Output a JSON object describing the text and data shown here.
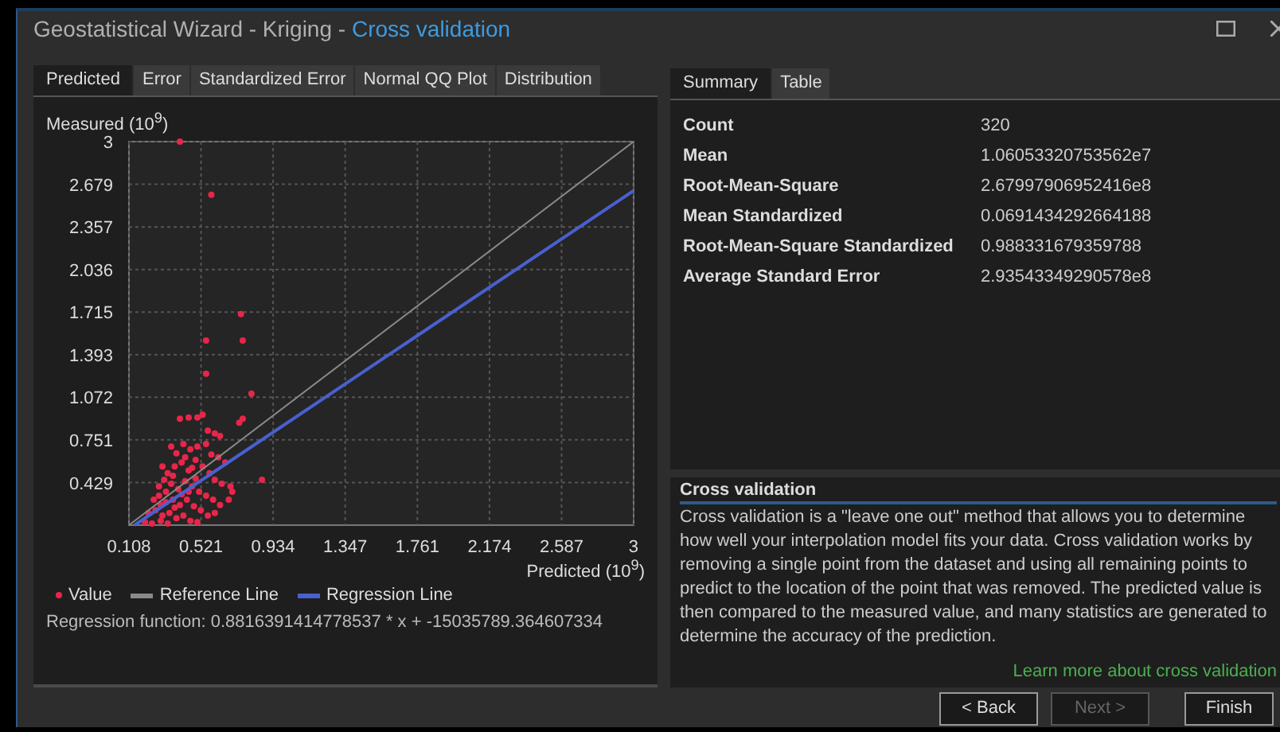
{
  "window": {
    "title_parts": [
      {
        "text": "Geostatistical Wizard - Kriging - ",
        "highlight": false
      },
      {
        "text": "Cross validation",
        "highlight": true
      }
    ]
  },
  "left_tabs": [
    {
      "label": "Predicted",
      "selected": true
    },
    {
      "label": "Error",
      "selected": false
    },
    {
      "label": "Standardized Error",
      "selected": false
    },
    {
      "label": "Normal QQ Plot",
      "selected": false
    },
    {
      "label": "Distribution",
      "selected": false
    }
  ],
  "plot": {
    "ylabel": "Measured (10$^{9}$)",
    "xlabel": "Predicted (10$^{9}$)",
    "chart_data": {
      "type": "scatter",
      "grid": true,
      "xlim": [
        0.108,
        3
      ],
      "ylim": [
        0.108,
        3
      ],
      "xticks": [
        0.108,
        0.521,
        0.934,
        1.347,
        1.761,
        2.174,
        2.587,
        3
      ],
      "yticks": [
        0.429,
        0.751,
        1.072,
        1.393,
        1.715,
        2.036,
        2.357,
        2.679,
        3
      ],
      "series": [
        {
          "name": "Value",
          "color": "#e8264a",
          "x": [
            0.4,
            0.58,
            0.55,
            0.55,
            0.75,
            0.76,
            0.81,
            0.76,
            0.74,
            0.87,
            0.4,
            0.45,
            0.5,
            0.53,
            0.56,
            0.6,
            0.63,
            0.66,
            0.69,
            0.7,
            0.68,
            0.35,
            0.38,
            0.42,
            0.46,
            0.5,
            0.55,
            0.58,
            0.62,
            0.3,
            0.33,
            0.37,
            0.41,
            0.45,
            0.49,
            0.53,
            0.57,
            0.6,
            0.64,
            0.28,
            0.31,
            0.35,
            0.39,
            0.43,
            0.47,
            0.51,
            0.55,
            0.59,
            0.63,
            0.25,
            0.28,
            0.32,
            0.36,
            0.4,
            0.44,
            0.48,
            0.52,
            0.56,
            0.6,
            0.22,
            0.26,
            0.3,
            0.34,
            0.38,
            0.42,
            0.46,
            0.5,
            0.2,
            0.24,
            0.29,
            0.33,
            0.37,
            0.41,
            0.45,
            0.49,
            0.32,
            0.36,
            0.29,
            0.43,
            0.47
          ],
          "values": [
            3.0,
            2.6,
            1.5,
            1.25,
            1.7,
            1.5,
            1.1,
            0.91,
            0.88,
            0.45,
            0.91,
            0.92,
            0.92,
            0.94,
            0.82,
            0.8,
            0.78,
            0.58,
            0.4,
            0.36,
            0.3,
            0.7,
            0.65,
            0.72,
            0.68,
            0.7,
            0.72,
            0.64,
            0.62,
            0.55,
            0.5,
            0.55,
            0.58,
            0.52,
            0.6,
            0.55,
            0.5,
            0.45,
            0.42,
            0.4,
            0.45,
            0.42,
            0.38,
            0.44,
            0.4,
            0.36,
            0.33,
            0.3,
            0.26,
            0.3,
            0.33,
            0.28,
            0.3,
            0.26,
            0.3,
            0.25,
            0.22,
            0.18,
            0.2,
            0.2,
            0.22,
            0.18,
            0.2,
            0.16,
            0.18,
            0.14,
            0.13,
            0.13,
            0.12,
            0.14,
            0.12,
            0.24,
            0.34,
            0.36,
            0.46,
            0.36,
            0.48,
            0.26,
            0.62,
            0.54
          ]
        },
        {
          "name": "Reference Line",
          "type": "line",
          "color": "#8a8a8a",
          "x": [
            0.108,
            3
          ],
          "values": [
            0.108,
            3
          ]
        },
        {
          "name": "Regression Line",
          "type": "line",
          "color": "#4a5fd0",
          "x": [
            0.14,
            3
          ],
          "values": [
            0.108,
            2.63
          ]
        }
      ]
    }
  },
  "regression_function": "Regression function: 0.8816391414778537 * x + -15035789.364607334",
  "right_tabs": [
    {
      "label": "Summary",
      "selected": true
    },
    {
      "label": "Table",
      "selected": false
    }
  ],
  "summary": [
    {
      "label": "Count",
      "value": "320"
    },
    {
      "label": "Mean",
      "value": "1.06053320753562e7"
    },
    {
      "label": "Root-Mean-Square",
      "value": "2.67997906952416e8"
    },
    {
      "label": "Mean Standardized",
      "value": "0.0691434292664188"
    },
    {
      "label": "Root-Mean-Square Standardized",
      "value": "0.988331679359788"
    },
    {
      "label": "Average Standard Error",
      "value": "2.93543349290578e8"
    }
  ],
  "help": {
    "title": "Cross validation",
    "text": "Cross validation is a \"leave one out\" method that allows you to determine how well your interpolation model fits your data. Cross validation works by removing a single point from the dataset and using all remaining points to predict to the location of the point that was removed. The predicted value is then compared to the measured value, and many statistics are generated to determine the accuracy of the prediction.",
    "link": "Learn more about cross validation"
  },
  "buttons": [
    {
      "label": "< Back",
      "disabled": false
    },
    {
      "label": "Next >",
      "disabled": true
    },
    {
      "label": "Finish",
      "disabled": false
    }
  ]
}
